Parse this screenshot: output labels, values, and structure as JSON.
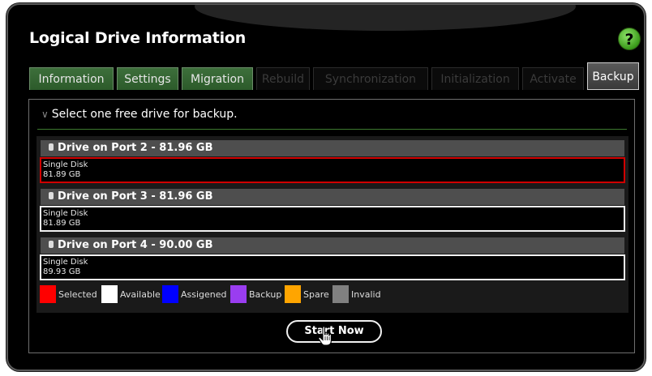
{
  "window": {
    "title": "Logical Drive Information",
    "help_label": "?"
  },
  "tabs": [
    {
      "label": "Information",
      "state": "enabled"
    },
    {
      "label": "Settings",
      "state": "enabled"
    },
    {
      "label": "Migration",
      "state": "enabled"
    },
    {
      "label": "Rebuild",
      "state": "disabled"
    },
    {
      "label": "Synchronization",
      "state": "disabled"
    },
    {
      "label": "Initialization",
      "state": "disabled"
    },
    {
      "label": "Activate",
      "state": "disabled"
    },
    {
      "label": "Backup",
      "state": "active"
    }
  ],
  "section": {
    "heading": "Select one free drive for backup."
  },
  "drives": [
    {
      "header": "Drive on Port 2 - 81.96 GB",
      "type": "Single Disk",
      "size": "81.89 GB",
      "status": "selected"
    },
    {
      "header": "Drive on Port 3 - 81.96 GB",
      "type": "Single Disk",
      "size": "81.89 GB",
      "status": "available"
    },
    {
      "header": "Drive on Port 4 - 90.00 GB",
      "type": "Single Disk",
      "size": "89.93 GB",
      "status": "available"
    }
  ],
  "legend": [
    {
      "label": "Selected",
      "color": "#ff0000"
    },
    {
      "label": "Available",
      "color": "#ffffff"
    },
    {
      "label": "Assigened",
      "color": "#0000ff"
    },
    {
      "label": "Backup",
      "color": "#9a3df0"
    },
    {
      "label": "Spare",
      "color": "#ffa500"
    },
    {
      "label": "Invalid",
      "color": "#808080"
    }
  ],
  "actions": {
    "start_label": "Start Now"
  }
}
